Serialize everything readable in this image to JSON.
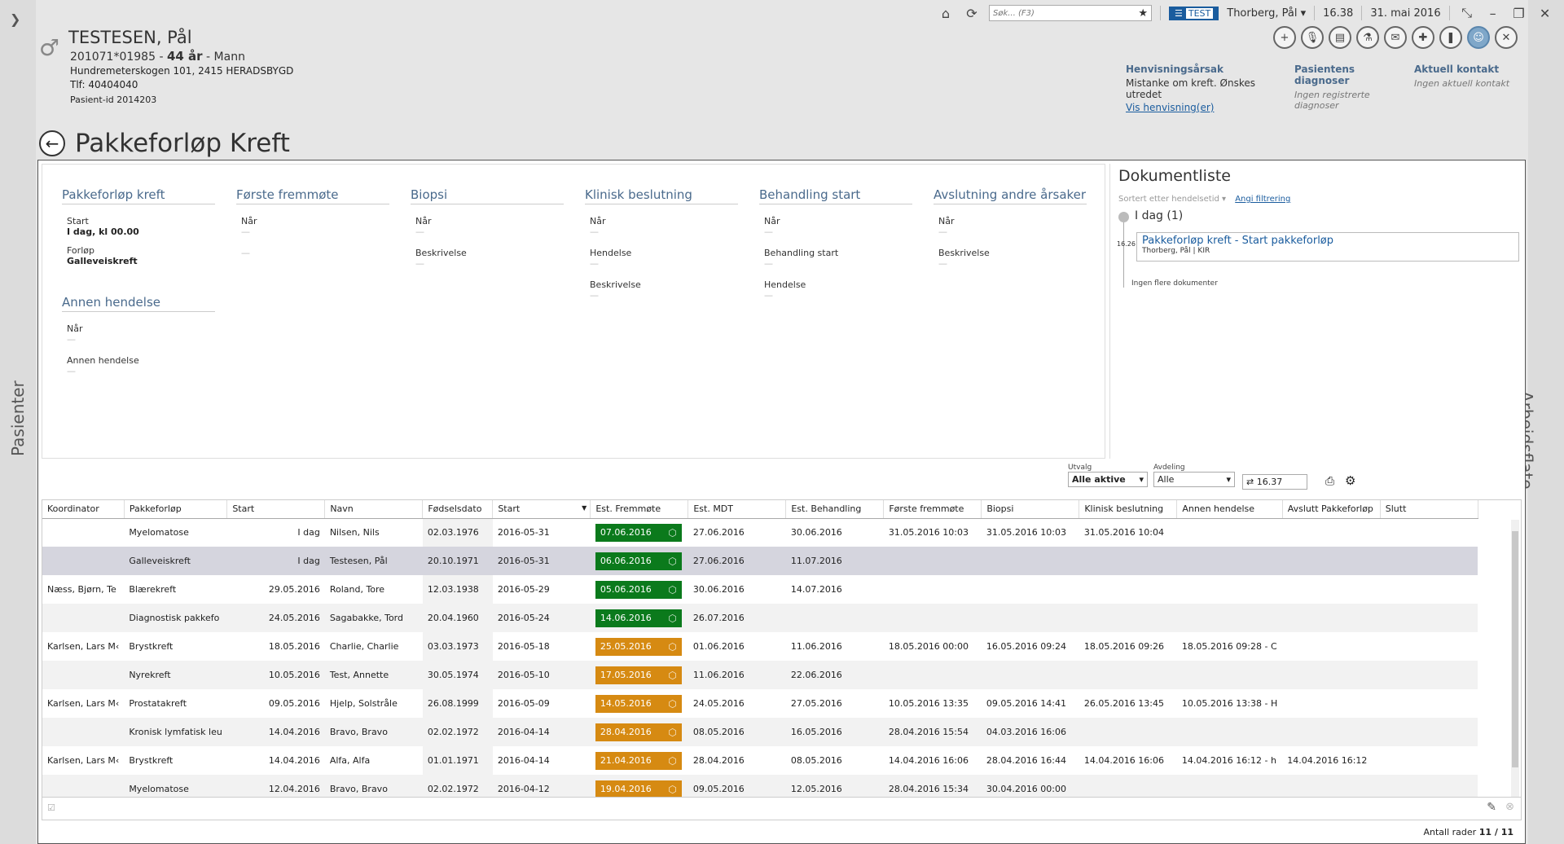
{
  "rails": {
    "left": "Pasienter",
    "right": "Arbeidsflate"
  },
  "topbar": {
    "search_placeholder": "Søk... (F3)",
    "env_badge": "TEST",
    "user": "Thorberg, Pål ▾",
    "time": "16.38",
    "date": "31. mai 2016"
  },
  "patient": {
    "name": "TESTESEN, Pål",
    "ssn": "201071*01985",
    "age": "44 år",
    "sex": "Mann",
    "address": "Hundremeterskogen 101, 2415 HERADSBYGD",
    "phone": "Tlf: 40404040",
    "patient_id": "Pasient-id 2014203"
  },
  "referral": {
    "h1": "Henvisningsårsak",
    "v1": "Mistanke om kreft. Ønskes utredet",
    "link": "Vis henvisning(er)",
    "h2": "Pasientens diagnoser",
    "v2": "Ingen registrerte diagnoser",
    "h3": "Aktuell kontakt",
    "v3": "Ingen aktuell kontakt"
  },
  "page_title": "Pakkeforløp Kreft",
  "stages": {
    "s1": {
      "title": "Pakkeforløp kreft",
      "l1": "Start",
      "v1": "I dag, kl 00.00",
      "l2": "Forløp",
      "v2": "Galleveiskreft"
    },
    "s2": {
      "title": "Første fremmøte",
      "l1": "Når",
      "d1": "—",
      "d2": "—"
    },
    "s3": {
      "title": "Biopsi",
      "l1": "Når",
      "d1": "—",
      "l2": "Beskrivelse",
      "d2": "—"
    },
    "s4": {
      "title": "Klinisk beslutning",
      "l1": "Når",
      "d1": "—",
      "l2": "Hendelse",
      "d2": "—",
      "l3": "Beskrivelse",
      "d3": "—"
    },
    "s5": {
      "title": "Behandling start",
      "l1": "Når",
      "d1": "—",
      "l2": "Behandling start",
      "d2": "—",
      "l3": "Hendelse",
      "d3": "—"
    },
    "s6": {
      "title": "Avslutning andre årsaker",
      "l1": "Når",
      "d1": "—",
      "l2": "Beskrivelse",
      "d2": "—"
    },
    "s7": {
      "title": "Annen hendelse",
      "l1": "Når",
      "d1": "—",
      "l2": "Annen hendelse",
      "d2": "—"
    }
  },
  "doclist": {
    "title": "Dokumentliste",
    "sort": "Sortert etter hendelsetid ▾",
    "filter": "Angi filtrering",
    "day": "I dag (1)",
    "time": "16.26",
    "doc_title": "Pakkeforløp kreft - Start pakkeforløp",
    "doc_sub": "Thorberg, Pål | KIR",
    "nomore": "Ingen flere dokumenter"
  },
  "filters": {
    "utvalg_label": "Utvalg",
    "utvalg": "Alle aktive",
    "avdeling_label": "Avdeling",
    "avdeling": "Alle",
    "refresh_time": "16.37"
  },
  "columns": [
    "Koordinator",
    "Pakkeforløp",
    "Start",
    "Navn",
    "Fødselsdato",
    "Start",
    "Est. Fremmøte",
    "Est. MDT",
    "Est. Behandling",
    "Første fremmøte",
    "Biopsi",
    "Klinisk beslutning",
    "Annen hendelse",
    "Avslutt Pakkeforløp",
    "Slutt"
  ],
  "rows": [
    {
      "c0": "",
      "c1": "Myelomatose",
      "c2": "I dag",
      "c3": "Nilsen, Nils",
      "c4": "02.03.1976",
      "c5": "2016-05-31",
      "c6": "07.06.2016",
      "color": "green",
      "c7": "27.06.2016",
      "c8": "30.06.2016",
      "c9": "31.05.2016 10:03",
      "c10": "31.05.2016 10:03",
      "c11": "31.05.2016 10:04",
      "c12": "",
      "c13": "",
      "c14": ""
    },
    {
      "c0": "",
      "c1": "Galleveiskreft",
      "c2": "I dag",
      "c3": "Testesen, Pål",
      "c4": "20.10.1971",
      "c5": "2016-05-31",
      "c6": "06.06.2016",
      "color": "green",
      "c7": "27.06.2016",
      "c8": "11.07.2016",
      "c9": "",
      "c10": "",
      "c11": "",
      "c12": "",
      "c13": "",
      "c14": ""
    },
    {
      "c0": "Næss, Bjørn, Te",
      "c1": "Blærekreft",
      "c2": "29.05.2016",
      "c3": "Roland, Tore",
      "c4": "12.03.1938",
      "c5": "2016-05-29",
      "c6": "05.06.2016",
      "color": "green",
      "c7": "30.06.2016",
      "c8": "14.07.2016",
      "c9": "",
      "c10": "",
      "c11": "",
      "c12": "",
      "c13": "",
      "c14": ""
    },
    {
      "c0": "",
      "c1": "Diagnostisk pakkefo",
      "c2": "24.05.2016",
      "c3": "Sagabakke, Tord",
      "c4": "20.04.1960",
      "c5": "2016-05-24",
      "c6": "14.06.2016",
      "color": "green",
      "c7": "26.07.2016",
      "c8": "",
      "c9": "",
      "c10": "",
      "c11": "",
      "c12": "",
      "c13": "",
      "c14": ""
    },
    {
      "c0": "Karlsen, Lars M‹",
      "c1": "Brystkreft",
      "c2": "18.05.2016",
      "c3": "Charlie, Charlie",
      "c4": "03.03.1973",
      "c5": "2016-05-18",
      "c6": "25.05.2016",
      "color": "orange",
      "c7": "01.06.2016",
      "c8": "11.06.2016",
      "c9": "18.05.2016 00:00",
      "c10": "16.05.2016 09:24",
      "c11": "18.05.2016 09:26",
      "c12": "18.05.2016 09:28 - C",
      "c13": "",
      "c14": ""
    },
    {
      "c0": "",
      "c1": "Nyrekreft",
      "c2": "10.05.2016",
      "c3": "Test, Annette",
      "c4": "30.05.1974",
      "c5": "2016-05-10",
      "c6": "17.05.2016",
      "color": "orange",
      "c7": "11.06.2016",
      "c8": "22.06.2016",
      "c9": "",
      "c10": "",
      "c11": "",
      "c12": "",
      "c13": "",
      "c14": ""
    },
    {
      "c0": "Karlsen, Lars M‹",
      "c1": "Prostatakreft",
      "c2": "09.05.2016",
      "c3": "Hjelp, Solstråle",
      "c4": "26.08.1999",
      "c5": "2016-05-09",
      "c6": "14.05.2016",
      "color": "orange",
      "c7": "24.05.2016",
      "c8": "27.05.2016",
      "c9": "10.05.2016 13:35",
      "c10": "09.05.2016 14:41",
      "c11": "26.05.2016 13:45",
      "c12": "10.05.2016 13:38 - H",
      "c13": "",
      "c14": ""
    },
    {
      "c0": "",
      "c1": "Kronisk lymfatisk leu",
      "c2": "14.04.2016",
      "c3": "Bravo, Bravo",
      "c4": "02.02.1972",
      "c5": "2016-04-14",
      "c6": "28.04.2016",
      "color": "orange",
      "c7": "08.05.2016",
      "c8": "16.05.2016",
      "c9": "28.04.2016 15:54",
      "c10": "04.03.2016 16:06",
      "c11": "",
      "c12": "",
      "c13": "",
      "c14": ""
    },
    {
      "c0": "Karlsen, Lars M‹",
      "c1": "Brystkreft",
      "c2": "14.04.2016",
      "c3": "Alfa, Alfa",
      "c4": "01.01.1971",
      "c5": "2016-04-14",
      "c6": "21.04.2016",
      "color": "orange",
      "c7": "28.04.2016",
      "c8": "08.05.2016",
      "c9": "14.04.2016 16:06",
      "c10": "28.04.2016 16:44",
      "c11": "14.04.2016 16:06",
      "c12": "14.04.2016 16:12 - h",
      "c13": "14.04.2016 16:12",
      "c14": ""
    },
    {
      "c0": "",
      "c1": "Myelomatose",
      "c2": "12.04.2016",
      "c3": "Bravo, Bravo",
      "c4": "02.02.1972",
      "c5": "2016-04-12",
      "c6": "19.04.2016",
      "color": "orange",
      "c7": "09.05.2016",
      "c8": "12.05.2016",
      "c9": "28.04.2016 15:34",
      "c10": "30.04.2016 00:00",
      "c11": "",
      "c12": "",
      "c13": "",
      "c14": ""
    }
  ],
  "row_count_label": "Antall rader",
  "row_count": "11 / 11"
}
